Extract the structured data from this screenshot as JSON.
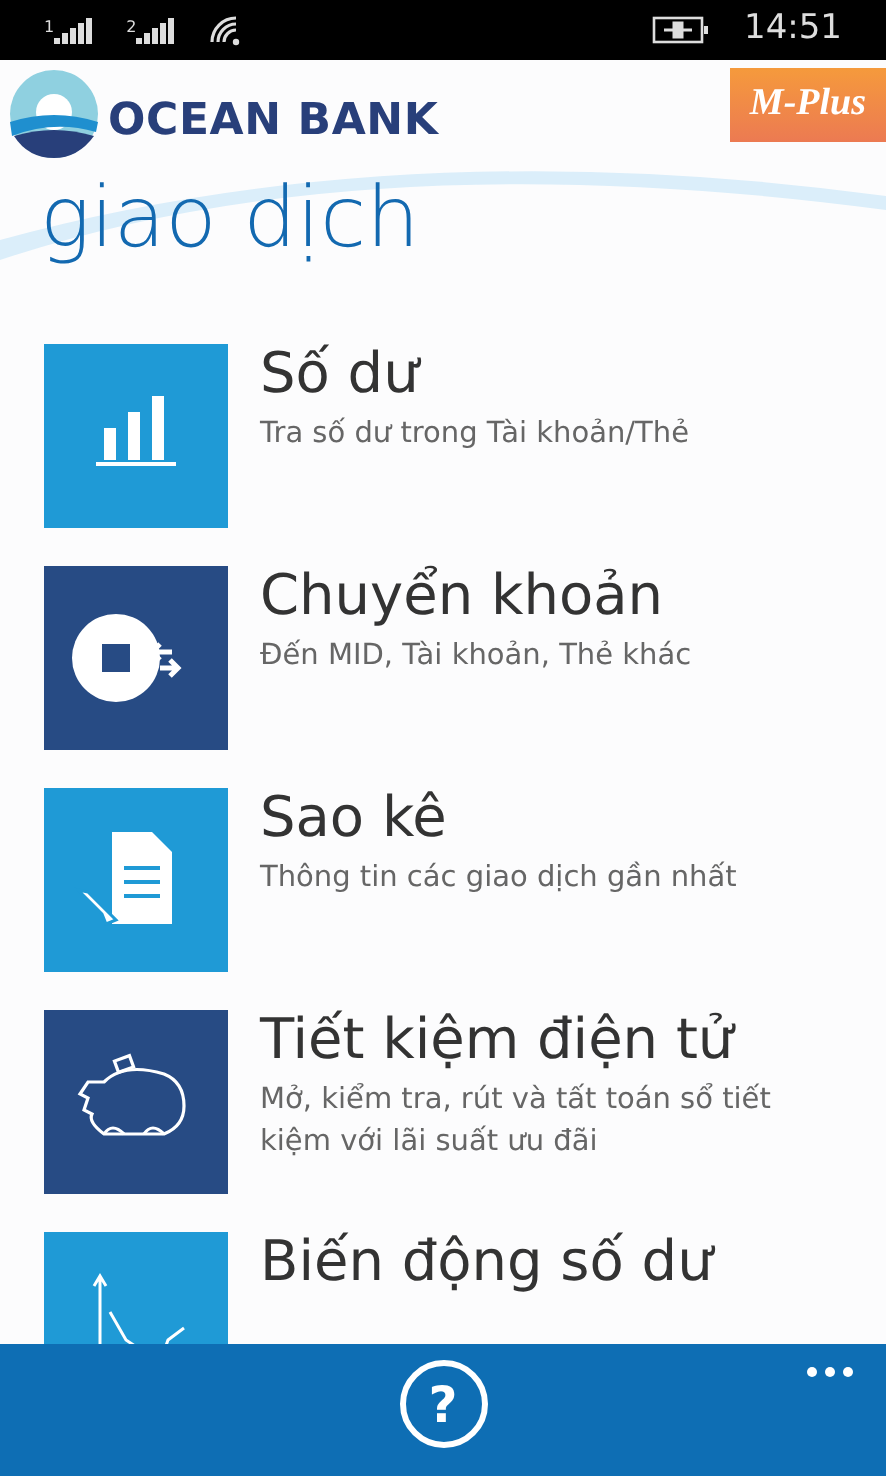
{
  "status_bar": {
    "sims": [
      "1",
      "2"
    ],
    "time": "14:51"
  },
  "header": {
    "bank_name": "OCEAN BANK",
    "badge": "M-Plus",
    "title": "giao dịch"
  },
  "items": [
    {
      "title": "Số dư",
      "subtitle": "Tra số dư trong Tài khoản/Thẻ",
      "kind": "balance",
      "color": "#1f9ad6"
    },
    {
      "title": "Chuyển khoản",
      "subtitle": "Đến MID, Tài khoản, Thẻ khác",
      "kind": "transfer",
      "color": "#274b84"
    },
    {
      "title": "Sao kê",
      "subtitle": "Thông tin các giao dịch gần nhất",
      "kind": "statement",
      "color": "#1f9ad6"
    },
    {
      "title": "Tiết kiệm điện tử",
      "subtitle": "Mở, kiểm tra, rút và tất toán sổ tiết kiệm với lãi suất ưu đãi",
      "kind": "savings",
      "color": "#274b84"
    },
    {
      "title": "Biến động số dư",
      "kind": "chart",
      "color": "#1f9ad6"
    }
  ],
  "app_bar": {
    "help_label": "?"
  }
}
